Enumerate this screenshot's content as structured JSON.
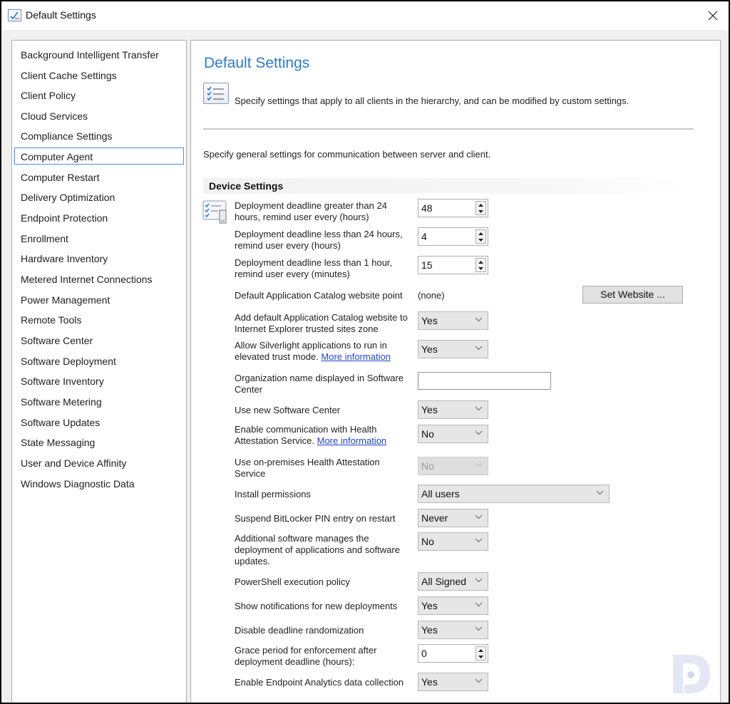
{
  "window": {
    "title": "Default Settings",
    "close_label": "×"
  },
  "sidebar": {
    "selected_index": 5,
    "items": [
      {
        "label": "Background Intelligent Transfer"
      },
      {
        "label": "Client Cache Settings"
      },
      {
        "label": "Client Policy"
      },
      {
        "label": "Cloud Services"
      },
      {
        "label": "Compliance Settings"
      },
      {
        "label": "Computer Agent"
      },
      {
        "label": "Computer Restart"
      },
      {
        "label": "Delivery Optimization"
      },
      {
        "label": "Endpoint Protection"
      },
      {
        "label": "Enrollment"
      },
      {
        "label": "Hardware Inventory"
      },
      {
        "label": "Metered Internet Connections"
      },
      {
        "label": "Power Management"
      },
      {
        "label": "Remote Tools"
      },
      {
        "label": "Software Center"
      },
      {
        "label": "Software Deployment"
      },
      {
        "label": "Software Inventory"
      },
      {
        "label": "Software Metering"
      },
      {
        "label": "Software Updates"
      },
      {
        "label": "State Messaging"
      },
      {
        "label": "User and Device Affinity"
      },
      {
        "label": "Windows Diagnostic Data"
      }
    ]
  },
  "content": {
    "title": "Default Settings",
    "description": "Specify settings that apply to all clients in the hierarchy, and can be modified by custom settings.",
    "general_description": "Specify general settings for communication between server and client.",
    "section_title": "Device Settings",
    "settings": {
      "deadline_gt24": {
        "label": "Deployment deadline greater than 24 hours, remind user every (hours)",
        "value": "48"
      },
      "deadline_lt24": {
        "label": "Deployment deadline less than 24 hours, remind user every (hours)",
        "value": "4"
      },
      "deadline_lt1": {
        "label": "Deployment deadline less than 1 hour, remind user every (minutes)",
        "value": "15"
      },
      "catalog_point": {
        "label": "Default Application Catalog website point",
        "value": "(none)",
        "button_label": "Set Website ..."
      },
      "catalog_trusted": {
        "label": "Add default Application Catalog website to Internet Explorer trusted sites zone",
        "value": "Yes"
      },
      "silverlight": {
        "label": "Allow Silverlight applications to run in elevated trust mode.",
        "link": "More information",
        "value": "Yes"
      },
      "org_name": {
        "label": "Organization name displayed in Software Center",
        "value": ""
      },
      "new_software_center": {
        "label": "Use new Software Center",
        "value": "Yes"
      },
      "health_attestation": {
        "label": "Enable communication with Health Attestation Service.",
        "link": "More information",
        "value": "No"
      },
      "onprem_health": {
        "label": "Use on-premises Health Attestation Service",
        "value": "No",
        "disabled": true
      },
      "install_permissions": {
        "label": "Install permissions",
        "value": "All users"
      },
      "bitlocker": {
        "label": "Suspend BitLocker PIN entry on restart",
        "value": "Never"
      },
      "additional_software": {
        "label": "Additional software manages the deployment of applications and software updates.",
        "value": "No"
      },
      "powershell": {
        "label": "PowerShell execution policy",
        "value": "All Signed"
      },
      "notifications": {
        "label": "Show notifications for new deployments",
        "value": "Yes"
      },
      "randomization": {
        "label": "Disable deadline randomization",
        "value": "Yes"
      },
      "grace_period": {
        "label": "Grace period for enforcement after deployment deadline (hours):",
        "value": "0"
      },
      "endpoint_analytics": {
        "label": "Enable Endpoint Analytics data collection",
        "value": "Yes"
      }
    }
  },
  "icons": {
    "window": "checklist-icon",
    "close": "close-icon",
    "header": "checklist-icon",
    "device": "device-settings-icon",
    "watermark": "logo-watermark-icon"
  },
  "colors": {
    "title_blue": "#2a7bd4",
    "link_blue": "#2244cc",
    "selection_border": "#4a90d9"
  }
}
